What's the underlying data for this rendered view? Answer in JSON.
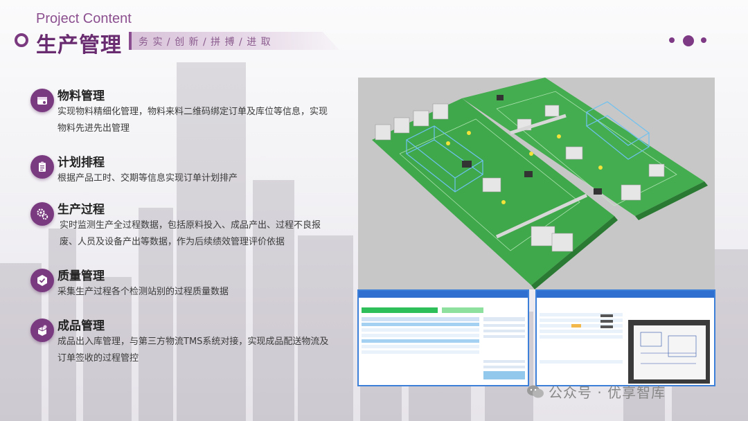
{
  "header": {
    "english_title": "Project Content",
    "chinese_title": "生产管理",
    "slogan": "务 实 / 创 新 / 拼 搏 / 进 取"
  },
  "items": [
    {
      "title": "物料管理",
      "desc": "实现物料精细化管理，物料来料二维码绑定订单及库位等信息，实现物料先进先出管理",
      "icon": "box-icon"
    },
    {
      "title": "计划排程",
      "desc": "根据产品工时、交期等信息实现订单计划排产",
      "icon": "clipboard-icon"
    },
    {
      "title": "生产过程",
      "desc": "实时监测生产全过程数据，包括原料投入、成品产出、过程不良报废、人员及设备产出等数据，作为后续绩效管理评价依据",
      "icon": "gears-icon"
    },
    {
      "title": "质量管理",
      "desc": "采集生产过程各个检测站别的过程质量数据",
      "icon": "quality-check-icon"
    },
    {
      "title": "成品管理",
      "desc": "成品出入库管理，与第三方物流TMS系统对接，实现成品配送物流及订单签收的过程管控",
      "icon": "product-box-icon"
    }
  ],
  "watermark": {
    "text": "公众号 · 优享智库",
    "icon": "wechat-icon"
  },
  "colors": {
    "brand": "#7a3a80",
    "accent": "#3b7fd8",
    "floor": "#3fa84b"
  }
}
